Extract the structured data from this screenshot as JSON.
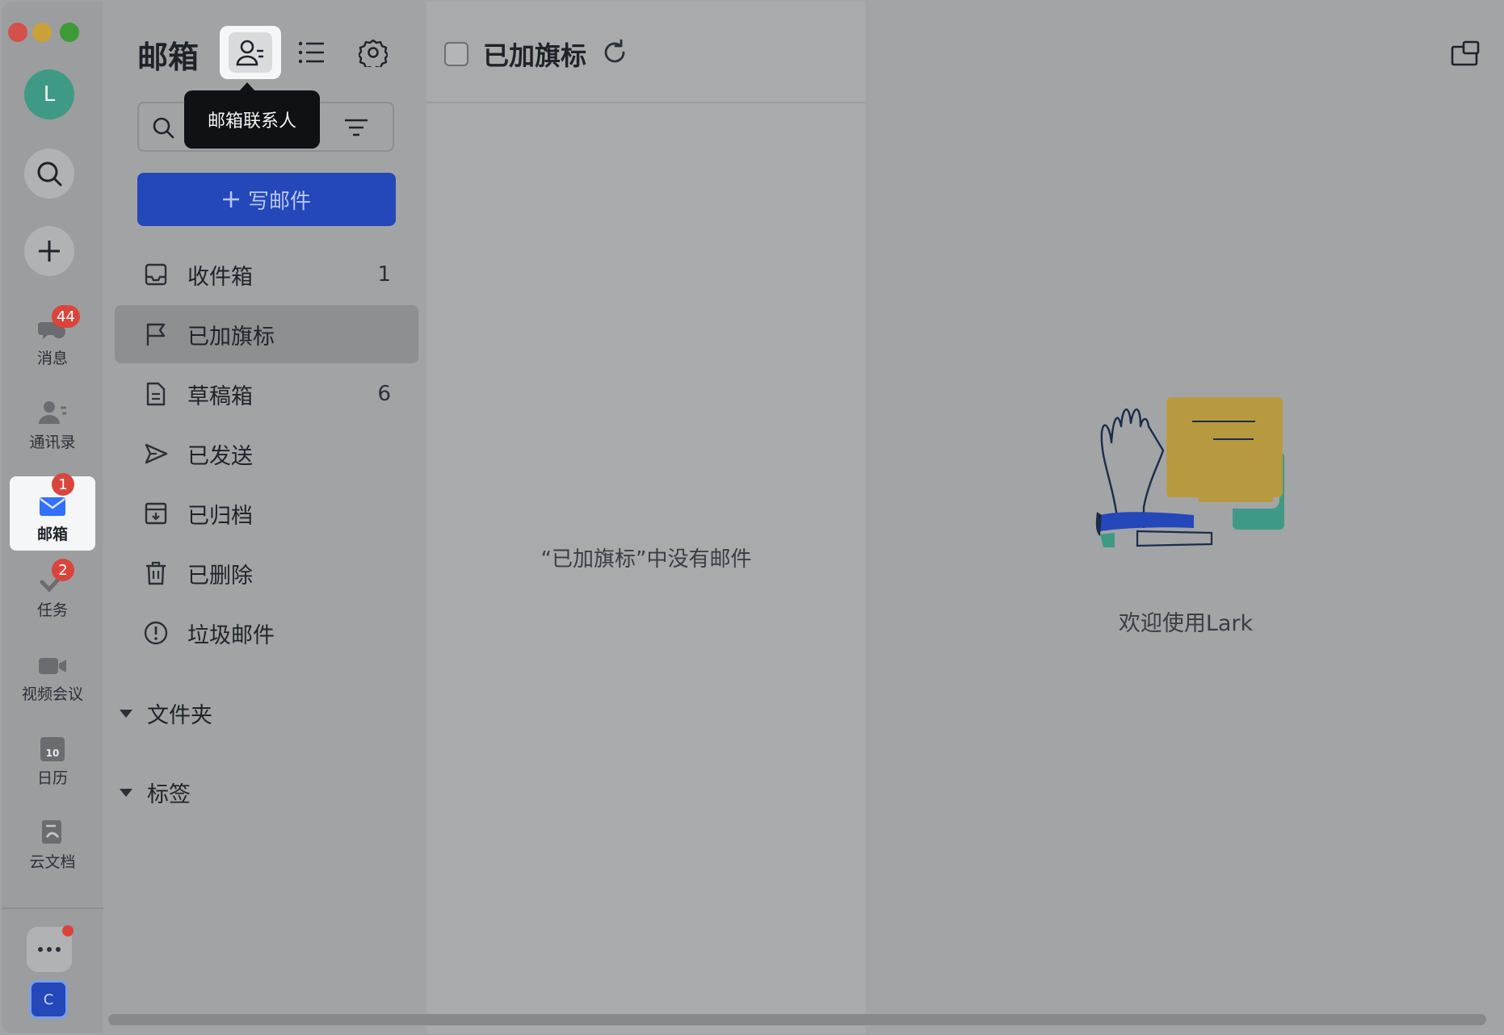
{
  "window": {
    "traffic_colors": [
      "#e0443e",
      "#dea123",
      "#1aad19"
    ]
  },
  "rail": {
    "avatar_letter": "L",
    "items": [
      {
        "label": "消息",
        "badge": "44"
      },
      {
        "label": "通讯录",
        "badge": ""
      },
      {
        "label": "邮箱",
        "badge": "1"
      },
      {
        "label": "任务",
        "badge": "2"
      },
      {
        "label": "视频会议",
        "badge": ""
      },
      {
        "label": "日历",
        "badge": ""
      },
      {
        "label": "云文档",
        "badge": ""
      }
    ],
    "calendar_day": "10",
    "bottom_avatar_letter": "C",
    "accent_color": "#2447ba"
  },
  "folders_pane": {
    "title": "邮箱",
    "tooltip": "邮箱联系人",
    "compose_label": "写邮件",
    "items": [
      {
        "label": "收件箱",
        "count": "1",
        "icon": "inbox-icon"
      },
      {
        "label": "已加旗标",
        "count": "",
        "icon": "flag-icon",
        "selected": true
      },
      {
        "label": "草稿箱",
        "count": "6",
        "icon": "draft-icon"
      },
      {
        "label": "已发送",
        "count": "",
        "icon": "send-icon"
      },
      {
        "label": "已归档",
        "count": "",
        "icon": "archive-icon"
      },
      {
        "label": "已删除",
        "count": "",
        "icon": "trash-icon"
      },
      {
        "label": "垃圾邮件",
        "count": "",
        "icon": "spam-icon"
      }
    ],
    "sections": [
      {
        "label": "文件夹"
      },
      {
        "label": "标签"
      }
    ]
  },
  "mail_list": {
    "title": "已加旗标",
    "empty_message": "“已加旗标”中没有邮件"
  },
  "reader": {
    "welcome_text": "欢迎使用Lark"
  }
}
